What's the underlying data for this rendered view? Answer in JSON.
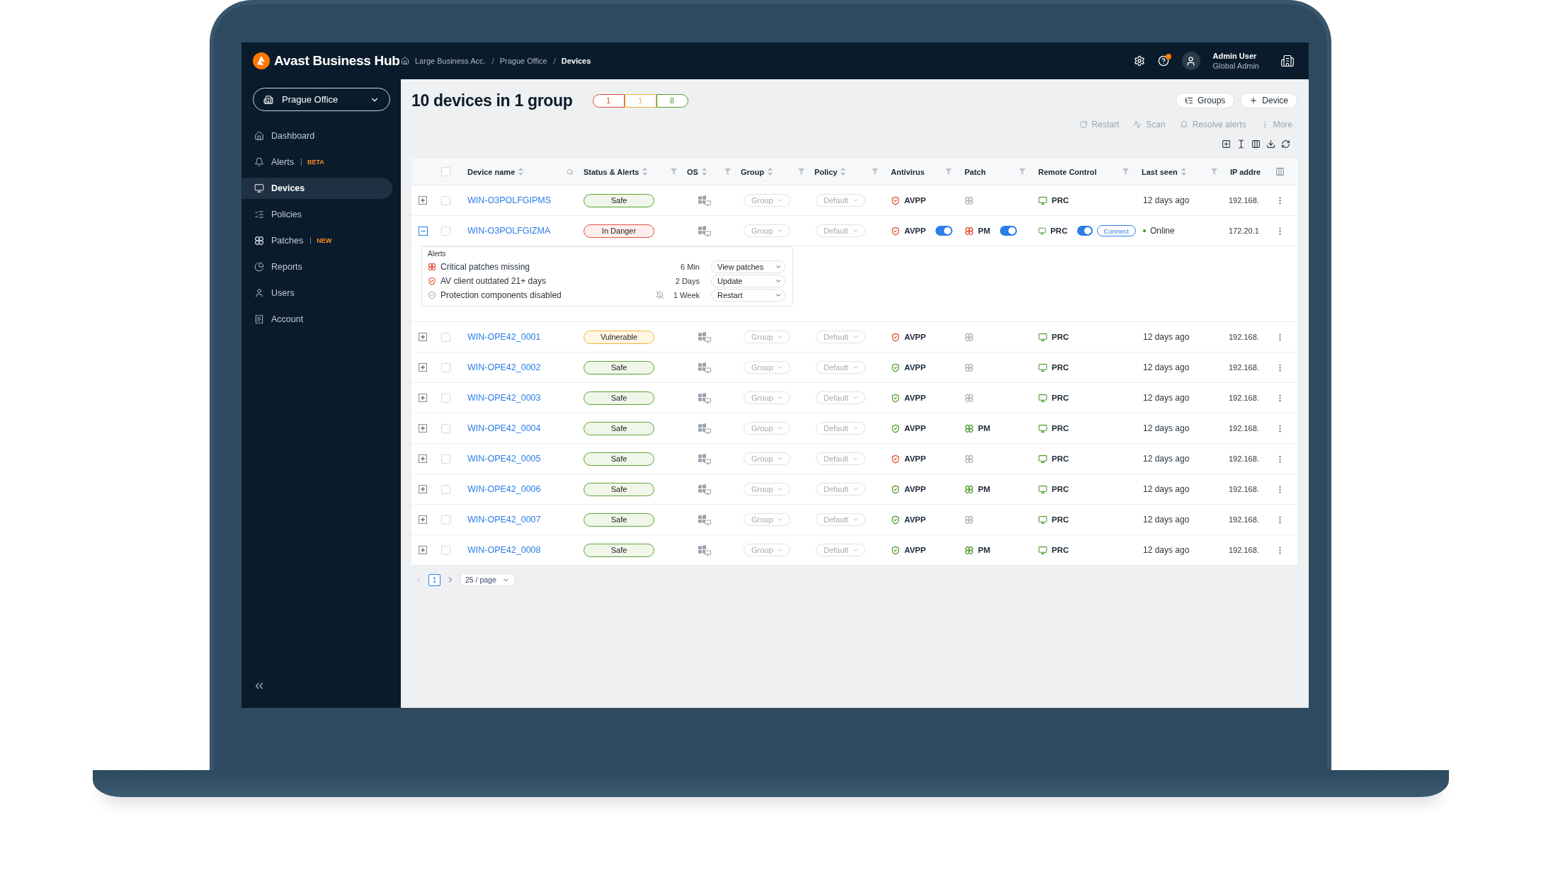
{
  "header": {
    "logo": "Avast Business Hub",
    "breadcrumbs": [
      "Large Business Acc.",
      "Prague Office",
      "Devices"
    ],
    "user_name": "Admin User",
    "user_role": "Global Admin",
    "help_notification": true
  },
  "sidebar": {
    "office": "Prague Office",
    "items": [
      {
        "label": "Dashboard",
        "selected": false
      },
      {
        "label": "Alerts",
        "badge": "BETA",
        "selected": false
      },
      {
        "label": "Devices",
        "selected": true
      },
      {
        "label": "Policies",
        "selected": false
      },
      {
        "label": "Patches",
        "badge": "NEW",
        "selected": false
      },
      {
        "label": "Reports",
        "selected": false
      },
      {
        "label": "Users",
        "selected": false
      },
      {
        "label": "Account",
        "selected": false
      }
    ]
  },
  "title": "10 devices in 1 group",
  "status_counts": [
    {
      "value": "1",
      "color": "#e0453a"
    },
    {
      "value": "1",
      "color": "#f0b43c"
    },
    {
      "value": "8",
      "color": "#4e9d2d"
    }
  ],
  "buttons": [
    "Groups",
    "Device"
  ],
  "actions": [
    "Restart",
    "Scan",
    "Resolve alerts",
    "More"
  ],
  "table": {
    "select_all_checked": false,
    "columns": [
      {
        "label": "Device name",
        "sortable": true,
        "searchable": true,
        "filterable": false
      },
      {
        "label": "Status & Alerts",
        "sortable": true,
        "searchable": false,
        "filterable": true
      },
      {
        "label": "OS",
        "sortable": true,
        "searchable": false,
        "filterable": true
      },
      {
        "label": "Group",
        "sortable": true,
        "searchable": false,
        "filterable": true
      },
      {
        "label": "Policy",
        "sortable": true,
        "searchable": false,
        "filterable": true
      },
      {
        "label": "Antivirus",
        "sortable": false,
        "searchable": false,
        "filterable": true
      },
      {
        "label": "Patch",
        "sortable": false,
        "searchable": false,
        "filterable": true
      },
      {
        "label": "Remote Control",
        "sortable": false,
        "searchable": false,
        "filterable": true
      },
      {
        "label": "Last seen",
        "sortable": true,
        "searchable": false,
        "filterable": true
      },
      {
        "label": "IP addre",
        "sortable": false,
        "searchable": false,
        "filterable": false
      }
    ],
    "rows": [
      {
        "name": "WIN-O3POLFGIPMS",
        "checked": false,
        "expanded": false,
        "status": {
          "label": "Safe",
          "kind": "safe"
        },
        "group": "Group",
        "policy": "Default",
        "antivirus": {
          "label": "AVPP",
          "ok": false
        },
        "patch": {
          "color": "#a9b0b6"
        },
        "remote": {
          "label": "PRC"
        },
        "last_seen": {
          "text": "12 days ago",
          "online": false
        },
        "ip": "192.168."
      },
      {
        "name": "WIN-O3POLFGIZMA",
        "checked": false,
        "expanded": true,
        "status": {
          "label": "In Danger",
          "kind": "danger"
        },
        "group": "Group",
        "policy": "Default",
        "antivirus": {
          "label": "AVPP",
          "ok": false,
          "on": true
        },
        "patch": {
          "color": "#e04b2e",
          "label": "PM",
          "on": true
        },
        "remote": {
          "label": "PRC",
          "on": true,
          "connect": "Connect"
        },
        "last_seen": {
          "text": "Online",
          "online": true
        },
        "ip": "172.20.1",
        "alerts": {
          "title": "Alerts",
          "items": [
            {
              "kind": "patch",
              "text": "Critical patches missing",
              "time": "6 Min",
              "muted": false,
              "action": "View patches"
            },
            {
              "kind": "shield",
              "text": "AV client outdated 21+ days",
              "time": "2 Days",
              "muted": false,
              "action": "Update"
            },
            {
              "kind": "shield_off",
              "text": "Protection components disabled",
              "time": "1 Week",
              "muted": true,
              "action": "Restart"
            }
          ]
        }
      },
      {
        "name": "WIN-OPE42_0001",
        "checked": false,
        "expanded": false,
        "status": {
          "label": "Vulnerable",
          "kind": "vulnerable"
        },
        "group": "Group",
        "policy": "Default",
        "antivirus": {
          "label": "AVPP",
          "ok": false
        },
        "patch": {
          "color": "#a9b0b6"
        },
        "remote": {
          "label": "PRC"
        },
        "last_seen": {
          "text": "12 days ago",
          "online": false
        },
        "ip": "192.168."
      },
      {
        "name": "WIN-OPE42_0002",
        "checked": false,
        "expanded": false,
        "status": {
          "label": "Safe",
          "kind": "safe"
        },
        "group": "Group",
        "policy": "Default",
        "antivirus": {
          "label": "AVPP",
          "ok": true
        },
        "patch": {
          "color": "#a9b0b6"
        },
        "remote": {
          "label": "PRC"
        },
        "last_seen": {
          "text": "12 days ago",
          "online": false
        },
        "ip": "192.168."
      },
      {
        "name": "WIN-OPE42_0003",
        "checked": false,
        "expanded": false,
        "status": {
          "label": "Safe",
          "kind": "safe"
        },
        "group": "Group",
        "policy": "Default",
        "antivirus": {
          "label": "AVPP",
          "ok": true
        },
        "patch": {
          "color": "#a9b0b6"
        },
        "remote": {
          "label": "PRC"
        },
        "last_seen": {
          "text": "12 days ago",
          "online": false
        },
        "ip": "192.168."
      },
      {
        "name": "WIN-OPE42_0004",
        "checked": false,
        "expanded": false,
        "status": {
          "label": "Safe",
          "kind": "safe"
        },
        "group": "Group",
        "policy": "Default",
        "antivirus": {
          "label": "AVPP",
          "ok": true
        },
        "patch": {
          "color": "#4c9a2a",
          "label": "PM"
        },
        "remote": {
          "label": "PRC"
        },
        "last_seen": {
          "text": "12 days ago",
          "online": false
        },
        "ip": "192.168."
      },
      {
        "name": "WIN-OPE42_0005",
        "checked": false,
        "expanded": false,
        "status": {
          "label": "Safe",
          "kind": "safe"
        },
        "group": "Group",
        "policy": "Default",
        "antivirus": {
          "label": "AVPP",
          "ok": false
        },
        "patch": {
          "color": "#a9b0b6"
        },
        "remote": {
          "label": "PRC"
        },
        "last_seen": {
          "text": "12 days ago",
          "online": false
        },
        "ip": "192.168."
      },
      {
        "name": "WIN-OPE42_0006",
        "checked": false,
        "expanded": false,
        "status": {
          "label": "Safe",
          "kind": "safe"
        },
        "group": "Group",
        "policy": "Default",
        "antivirus": {
          "label": "AVPP",
          "ok": true
        },
        "patch": {
          "color": "#4c9a2a",
          "label": "PM"
        },
        "remote": {
          "label": "PRC"
        },
        "last_seen": {
          "text": "12 days ago",
          "online": false
        },
        "ip": "192.168."
      },
      {
        "name": "WIN-OPE42_0007",
        "checked": false,
        "expanded": false,
        "status": {
          "label": "Safe",
          "kind": "safe"
        },
        "group": "Group",
        "policy": "Default",
        "antivirus": {
          "label": "AVPP",
          "ok": true
        },
        "patch": {
          "color": "#a9b0b6"
        },
        "remote": {
          "label": "PRC"
        },
        "last_seen": {
          "text": "12 days ago",
          "online": false
        },
        "ip": "192.168."
      },
      {
        "name": "WIN-OPE42_0008",
        "checked": false,
        "expanded": false,
        "status": {
          "label": "Safe",
          "kind": "safe"
        },
        "group": "Group",
        "policy": "Default",
        "antivirus": {
          "label": "AVPP",
          "ok": true
        },
        "patch": {
          "color": "#4c9a2a",
          "label": "PM"
        },
        "remote": {
          "label": "PRC"
        },
        "last_seen": {
          "text": "12 days ago",
          "online": false
        },
        "ip": "192.168."
      }
    ]
  },
  "pagination": {
    "pages": [
      {
        "label": "1",
        "selected": true
      }
    ],
    "page_size": "25 / page"
  }
}
